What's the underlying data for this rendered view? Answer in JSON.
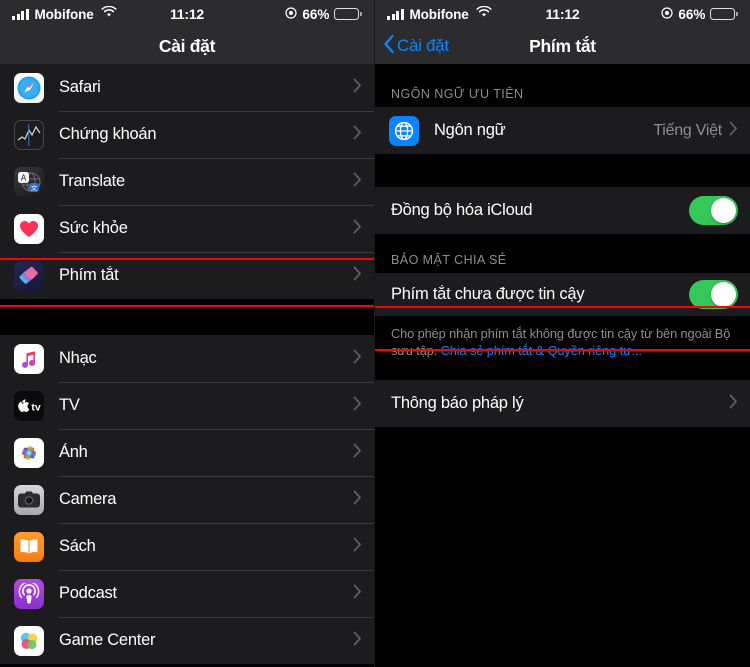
{
  "status_bar": {
    "carrier": "Mobifone",
    "time": "11:12",
    "battery_percent": "66%",
    "signal_icon": "cellular-bars-icon",
    "wifi_icon": "wifi-icon",
    "location_icon": "location-services-icon",
    "battery_icon": "battery-icon"
  },
  "colors": {
    "accent_blue": "#0a84ff",
    "toggle_green": "#34c759",
    "highlight_red": "#ff0000",
    "group_bg": "#1c1c1e",
    "page_bg": "#000000",
    "secondary_text": "#8e8e93"
  },
  "left_screen": {
    "nav": {
      "title": "Cài đặt"
    },
    "groups": [
      {
        "rows": [
          {
            "label": "Safari",
            "icon": "safari-icon",
            "accessory": "chevron-right-icon"
          },
          {
            "label": "Chứng khoán",
            "icon": "stocks-icon",
            "accessory": "chevron-right-icon"
          },
          {
            "label": "Translate",
            "icon": "translate-icon",
            "accessory": "chevron-right-icon"
          },
          {
            "label": "Sức khỏe",
            "icon": "health-icon",
            "accessory": "chevron-right-icon"
          },
          {
            "label": "Phím tắt",
            "icon": "shortcuts-icon",
            "accessory": "chevron-right-icon",
            "highlighted": true
          }
        ]
      },
      {
        "rows": [
          {
            "label": "Nhạc",
            "icon": "music-icon",
            "accessory": "chevron-right-icon"
          },
          {
            "label": "TV",
            "icon": "tv-icon",
            "accessory": "chevron-right-icon"
          },
          {
            "label": "Ảnh",
            "icon": "photos-icon",
            "accessory": "chevron-right-icon"
          },
          {
            "label": "Camera",
            "icon": "camera-icon",
            "accessory": "chevron-right-icon"
          },
          {
            "label": "Sách",
            "icon": "books-icon",
            "accessory": "chevron-right-icon"
          },
          {
            "label": "Podcast",
            "icon": "podcasts-icon",
            "accessory": "chevron-right-icon"
          },
          {
            "label": "Game Center",
            "icon": "game-center-icon",
            "accessory": "chevron-right-icon"
          }
        ]
      }
    ]
  },
  "right_screen": {
    "nav": {
      "back_label": "Cài đặt",
      "title": "Phím tắt",
      "back_icon": "chevron-left-icon"
    },
    "section_language": {
      "header": "NGÔN NGỮ ƯU TIÊN",
      "row": {
        "label": "Ngôn ngữ",
        "value": "Tiếng Việt",
        "icon": "globe-icon",
        "accessory": "chevron-right-icon"
      }
    },
    "section_icloud": {
      "row": {
        "label": "Đồng bộ hóa iCloud",
        "toggle_on": true
      }
    },
    "section_sharing": {
      "header": "BẢO MẬT CHIA SẺ",
      "row": {
        "label": "Phím tắt chưa được tin cậy",
        "toggle_on": true,
        "highlighted": true
      },
      "footnote_text": "Cho phép nhận phím tắt không được tin cậy từ bên ngoài Bộ sưu tập. ",
      "footnote_link": "Chia sẻ phím tắt & Quyền riêng tư..."
    },
    "section_legal": {
      "row": {
        "label": "Thông báo pháp lý",
        "accessory": "chevron-right-icon"
      }
    }
  }
}
